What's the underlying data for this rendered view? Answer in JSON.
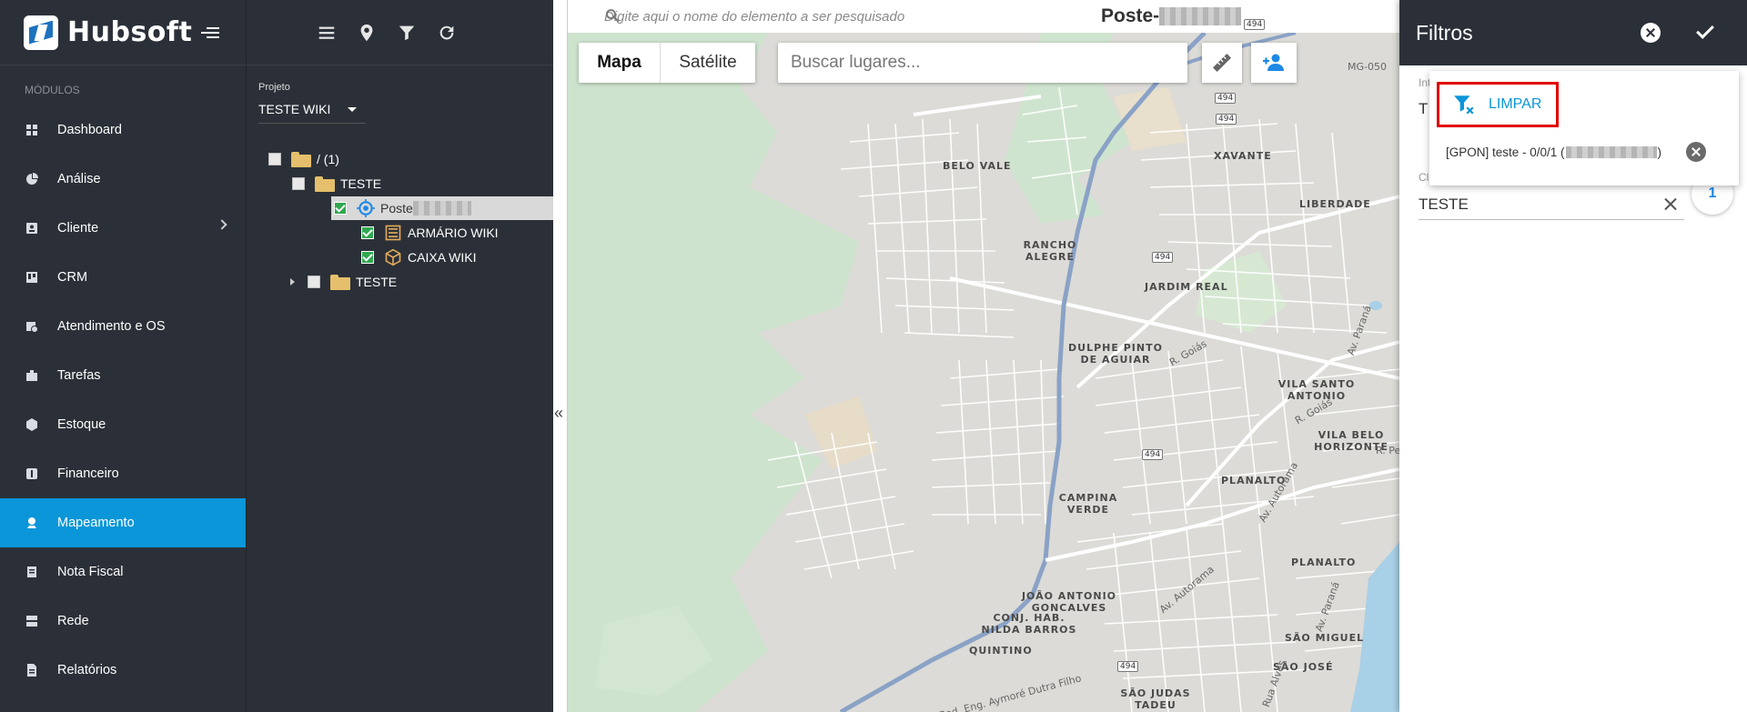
{
  "app": {
    "logo_text": "Hubsoft"
  },
  "sidebar": {
    "section_label": "MÓDULOS",
    "items": [
      {
        "label": "Dashboard",
        "icon": "dashboard-icon"
      },
      {
        "label": "Análise",
        "icon": "pie-chart-icon"
      },
      {
        "label": "Cliente",
        "icon": "contact-card-icon",
        "has_submenu": true
      },
      {
        "label": "CRM",
        "icon": "kanban-board-icon"
      },
      {
        "label": "Atendimento e OS",
        "icon": "calendar-clock-icon"
      },
      {
        "label": "Tarefas",
        "icon": "briefcase-icon"
      },
      {
        "label": "Estoque",
        "icon": "cube-icon"
      },
      {
        "label": "Financeiro",
        "icon": "dollar-icon"
      },
      {
        "label": "Mapeamento",
        "icon": "map-pin-icon",
        "active": true
      },
      {
        "label": "Nota Fiscal",
        "icon": "receipt-icon"
      },
      {
        "label": "Rede",
        "icon": "server-icon"
      },
      {
        "label": "Relatórios",
        "icon": "report-icon"
      }
    ]
  },
  "tree": {
    "toolbar": [
      "menu-icon",
      "map-marker-icon",
      "filter-icon",
      "refresh-icon"
    ],
    "project_label": "Projeto",
    "project_value": "TESTE WIKI",
    "nodes": [
      {
        "label": "/ (1)"
      },
      {
        "label": "TESTE"
      },
      {
        "label": "Poste"
      },
      {
        "label": "ARMÁRIO WIKI"
      },
      {
        "label": "CAIXA WIKI"
      },
      {
        "label": "TESTE"
      }
    ]
  },
  "map": {
    "search_placeholder": "Digite aqui o nome do elemento a ser pesquisado",
    "element_title": "Poste-",
    "map_type": {
      "map": "Mapa",
      "satellite": "Satélite",
      "selected": "Mapa"
    },
    "places_placeholder": "Buscar lugares...",
    "place_labels": [
      "BELO VALE",
      "XAVANTE",
      "LIBERDADE",
      "RANCHO ALEGRE",
      "JARDIM REAL",
      "DULPHE PINTO DE AGUIAR",
      "VILA SANTO ANTONIO",
      "VILA BELO HORIZONTE",
      "PLANALTO",
      "CAMPINA VERDE",
      "PLANALTO",
      "JOÃO ANTONIO GONCALVES",
      "CONJ. HAB. NILDA BARROS",
      "QUINTINO",
      "SÃO MIGUEL",
      "SÃO JOSÉ",
      "SÃO JUDAS TADEU"
    ],
    "road_labels": [
      "R. Goiás",
      "R. Goiás",
      "Av. Paraná",
      "R. Pe",
      "Av. Autorama",
      "Av. Autorama",
      "Av. Paraná",
      "Rod. Eng. Aymoré Dutra Filho",
      "Rua Alves",
      "MG-050"
    ],
    "shields": [
      "494",
      "494",
      "494",
      "494",
      "494",
      "494"
    ],
    "colors": {
      "land": "#e8e6e1",
      "green": "#cfe5d0",
      "road": "#ffffff",
      "highway": "#8aa2c6"
    }
  },
  "filter_panel": {
    "title": "Filtros",
    "field1_label": "Int",
    "field1_value": "T",
    "field2_label": "Cl",
    "field2_value": "TESTE",
    "count_badge": "1",
    "popup": {
      "clear_label": "LIMPAR",
      "entry_text": "[GPON] teste - 0/0/1 (",
      "entry_tail": ")"
    }
  },
  "colors": {
    "sidebar_bg": "#2b3038",
    "accent": "#0a96d8",
    "highlight_border": "#e10000"
  }
}
